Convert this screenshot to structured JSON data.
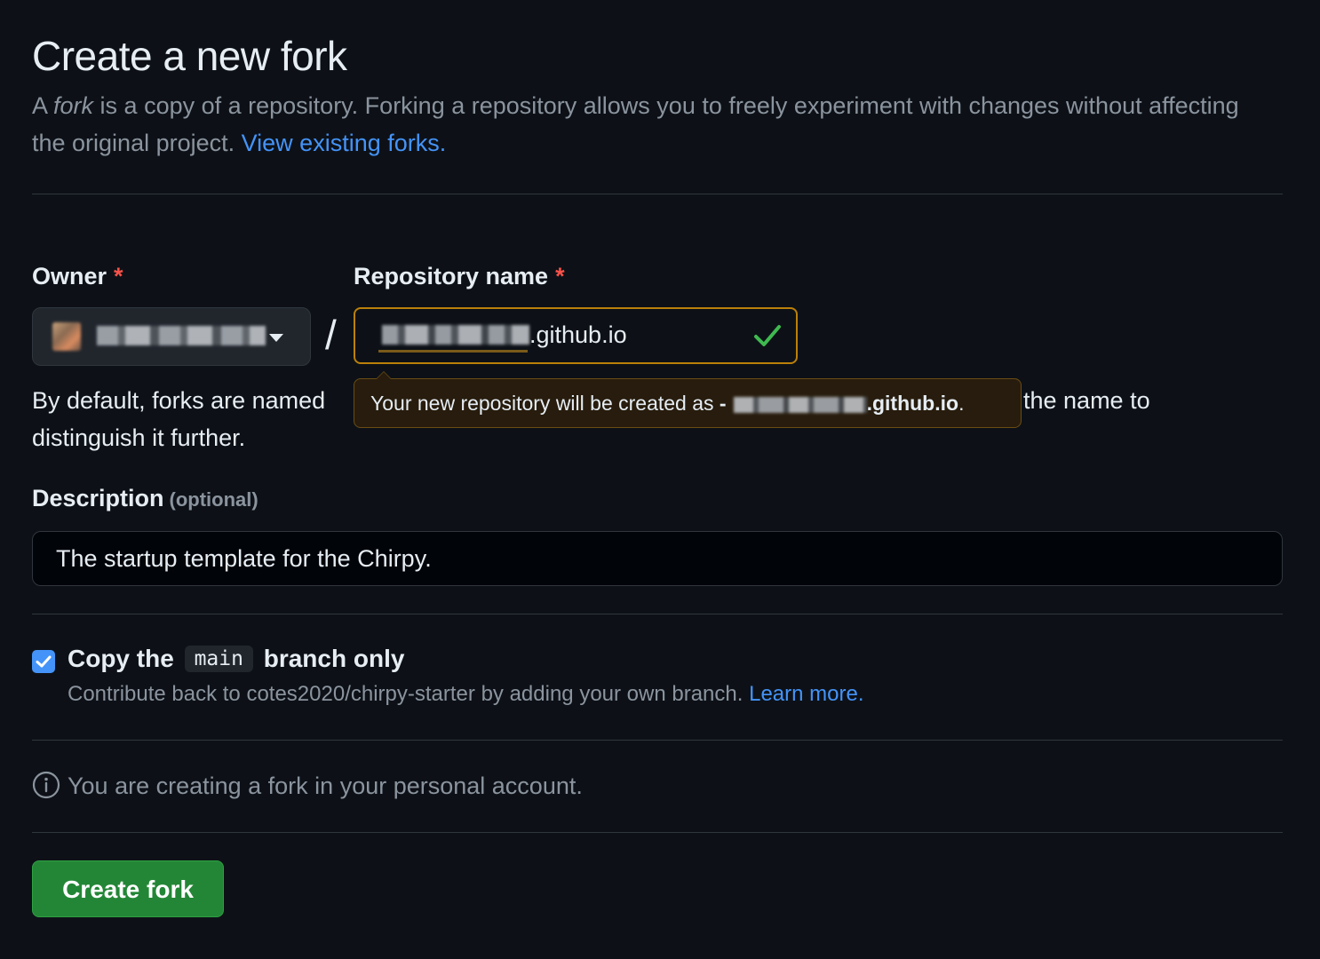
{
  "page": {
    "title": "Create a new fork",
    "intro_prefix": "A ",
    "intro_fork_word": "fork",
    "intro_rest": " is a copy of a repository. Forking a repository allows you to freely experiment with changes without affecting the original project. ",
    "view_forks_link": "View existing forks."
  },
  "owner": {
    "label": "Owner",
    "required_mark": "*",
    "selected_value_redacted": true
  },
  "separator": "/",
  "repo": {
    "label": "Repository name",
    "required_mark": "*",
    "value_suffix": ".github.io",
    "status": "valid",
    "tooltip_prefix": "Your new repository will be created as ",
    "tooltip_dash": "-",
    "tooltip_suffix": ".github.io",
    "tooltip_end": "."
  },
  "help": {
    "left": "By default, forks are named",
    "right": "the name to",
    "line2": "distinguish it further."
  },
  "description": {
    "label": "Description",
    "optional": "(optional)",
    "value": "The startup template for the Chirpy."
  },
  "copy_branch": {
    "checked": true,
    "label_prefix": "Copy the",
    "branch": "main",
    "label_suffix": "branch only",
    "note": "Contribute back to cotes2020/chirpy-starter by adding your own branch. ",
    "learn_more": "Learn more."
  },
  "info": {
    "text": "You are creating a fork in your personal account."
  },
  "actions": {
    "create_label": "Create fork"
  },
  "colors": {
    "background": "#0d1117",
    "link": "#4493f8",
    "primary_button": "#238636",
    "warning_border": "#bb8009",
    "success_check": "#3fb950",
    "required": "#f85149"
  }
}
